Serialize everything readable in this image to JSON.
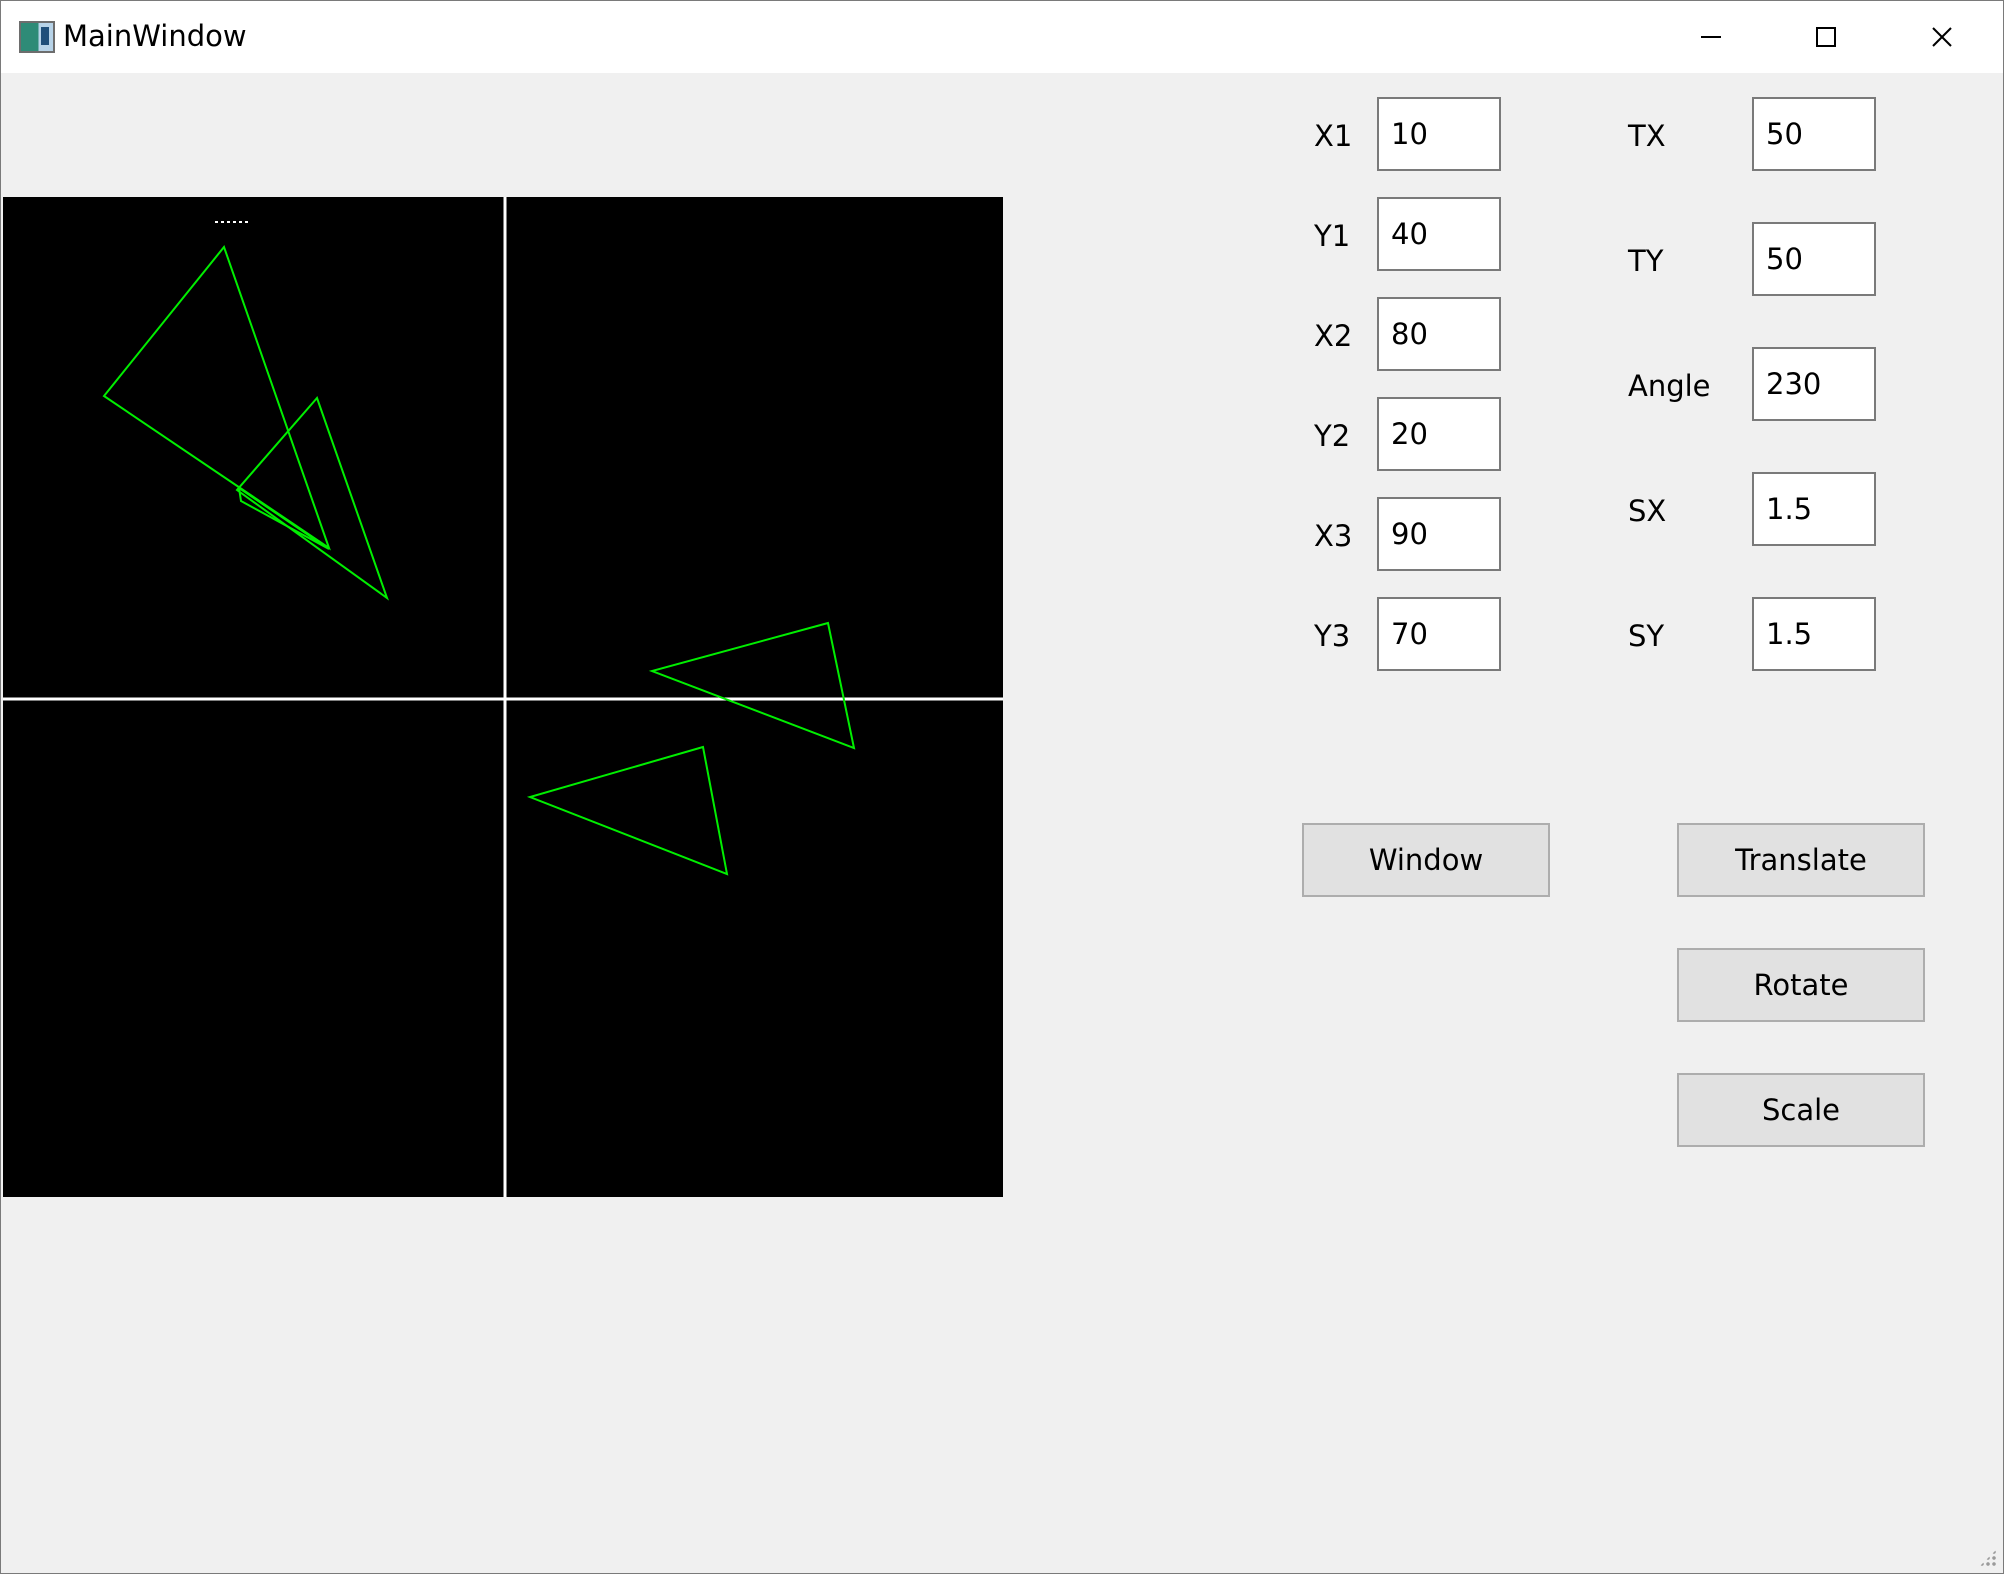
{
  "window": {
    "title": "MainWindow",
    "icon": "app-window-icon",
    "controls": [
      "minimize-icon",
      "maximize-icon",
      "close-icon"
    ]
  },
  "colors": {
    "canvas_bg": "#000000",
    "axis": "#ffffff",
    "shape": "#00ff00",
    "window_bg": "#f0f0f0"
  },
  "form": {
    "x1": {
      "label": "X1",
      "value": "10"
    },
    "y1": {
      "label": "Y1",
      "value": "40"
    },
    "x2": {
      "label": "X2",
      "value": "80"
    },
    "y2": {
      "label": "Y2",
      "value": "20"
    },
    "x3": {
      "label": "X3",
      "value": "90"
    },
    "y3": {
      "label": "Y3",
      "value": "70"
    },
    "tx": {
      "label": "TX",
      "value": "50"
    },
    "ty": {
      "label": "TY",
      "value": "50"
    },
    "angle": {
      "label": "Angle",
      "value": "230"
    },
    "sx": {
      "label": "SX",
      "value": "1.5"
    },
    "sy": {
      "label": "SY",
      "value": "1.5"
    }
  },
  "buttons": {
    "window": "Window",
    "translate": "Translate",
    "rotate": "Rotate",
    "scale": "Scale"
  }
}
